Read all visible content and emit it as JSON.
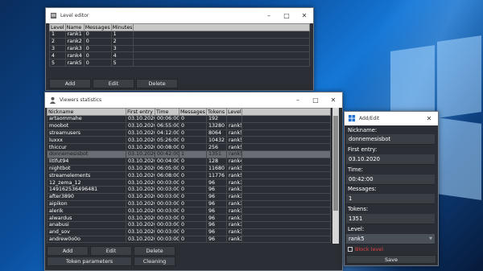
{
  "level_editor": {
    "title": "Level editor",
    "columns": [
      "Level",
      "Name",
      "Messages",
      "Minutes"
    ],
    "rows": [
      [
        "1",
        "rank1",
        "0",
        "1"
      ],
      [
        "2",
        "rank2",
        "0",
        "2"
      ],
      [
        "3",
        "rank3",
        "0",
        "3"
      ],
      [
        "4",
        "rank4",
        "0",
        "4"
      ],
      [
        "5",
        "rank5",
        "0",
        "5"
      ]
    ],
    "buttons": {
      "add": "Add",
      "edit": "Edit",
      "delete": "Delete"
    }
  },
  "viewers": {
    "title": "Viewers statistics",
    "columns": [
      "Nickname",
      "First entry",
      "Time",
      "Messages",
      "Tokens",
      "Level"
    ],
    "selected_index": 5,
    "rows": [
      [
        "artaommahe",
        "03.10.2020",
        "00:06:00",
        "0",
        "192",
        ""
      ],
      [
        "moobot",
        "03.10.2020",
        "06:55:00",
        "0",
        "13280",
        "rank5"
      ],
      [
        "streamusers",
        "03.10.2020",
        "04:12:00",
        "0",
        "8064",
        "rank5"
      ],
      [
        "luxxx",
        "03.10.2020",
        "05:26:00",
        "0",
        "10432",
        "rank5"
      ],
      [
        "thiccur",
        "03.10.2020",
        "00:08:00",
        "0",
        "256",
        "rank5"
      ],
      [
        "donnemesisbot",
        "03.10.2020",
        "00:42:00",
        "1",
        "1351",
        "rank5"
      ],
      [
        "litlfut94",
        "03.10.2020",
        "00:04:00",
        "0",
        "128",
        "rank4"
      ],
      [
        "nightbot",
        "03.10.2020",
        "06:05:00",
        "0",
        "11680",
        "rank5"
      ],
      [
        "streamelements",
        "03.10.2020",
        "06:08:00",
        "0",
        "11776",
        "rank5"
      ],
      [
        "12_zema_12",
        "03.10.2020",
        "00:03:00",
        "0",
        "96",
        "rank3"
      ],
      [
        "149162536496481",
        "03.10.2020",
        "00:03:00",
        "0",
        "96",
        "rank3"
      ],
      [
        "after3890",
        "03.10.2020",
        "00:03:00",
        "0",
        "96",
        "rank3"
      ],
      [
        "aipikon",
        "03.10.2020",
        "00:03:00",
        "0",
        "96",
        "rank3"
      ],
      [
        "alerik",
        "03.10.2020",
        "00:03:00",
        "0",
        "96",
        "rank3"
      ],
      [
        "alwardus",
        "03.10.2020",
        "00:03:00",
        "0",
        "96",
        "rank3"
      ],
      [
        "anabusi",
        "03.10.2020",
        "00:03:00",
        "0",
        "96",
        "rank3"
      ],
      [
        "and_sov",
        "03.10.2020",
        "00:03:00",
        "0",
        "96",
        "rank3"
      ],
      [
        "andrew0o0o",
        "03.10.2020",
        "00:03:00",
        "0",
        "96",
        "rank3"
      ]
    ],
    "buttons": {
      "add": "Add",
      "edit": "Edit",
      "delete": "Delete",
      "token_params": "Token parameters",
      "cleaning": "Cleaning"
    }
  },
  "add_edit": {
    "title": "Add/Edit",
    "nickname_label": "Nickname:",
    "nickname_value": "donnemesisbot",
    "first_entry_label": "First entry:",
    "first_entry_value": "03.10.2020",
    "time_label": "Time:",
    "time_value": "00:42:00",
    "messages_label": "Messages:",
    "messages_value": "1",
    "tokens_label": "Tokens:",
    "tokens_value": "1351",
    "level_label": "Level:",
    "level_value": "rank5",
    "block_level_label": "Block level",
    "save_label": "Save"
  },
  "colors": {
    "accent_block": "#e04040",
    "window_bg": "#2b2f35"
  },
  "icons": [
    "app-icon",
    "minimize-icon",
    "maximize-icon",
    "close-icon",
    "person-icon",
    "grid-icon",
    "chevron-down-icon"
  ]
}
